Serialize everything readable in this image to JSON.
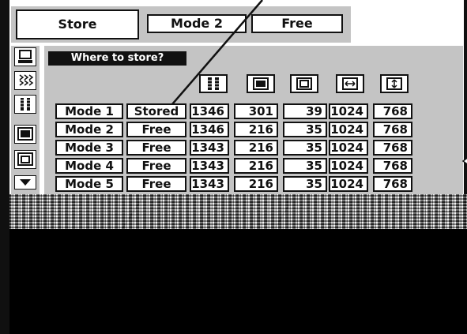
{
  "top_bar": {
    "store_label": "Store",
    "mode_label": "Mode 2",
    "free_label": "Free"
  },
  "panel": {
    "heading": "Where to store?",
    "column_icons": [
      "total-lines-icon",
      "horizontal-position-icon",
      "vertical-position-icon",
      "display-area-h-icon",
      "display-area-v-icon"
    ],
    "rows": [
      {
        "mode": "Mode 1",
        "status": "Stored",
        "total": "1346",
        "hpos": "301",
        "vpos": "39",
        "width": "1024",
        "height": "768"
      },
      {
        "mode": "Mode 2",
        "status": "Free",
        "total": "1346",
        "hpos": "216",
        "vpos": "35",
        "width": "1024",
        "height": "768"
      },
      {
        "mode": "Mode 3",
        "status": "Free",
        "total": "1343",
        "hpos": "216",
        "vpos": "35",
        "width": "1024",
        "height": "768"
      },
      {
        "mode": "Mode 4",
        "status": "Free",
        "total": "1343",
        "hpos": "216",
        "vpos": "35",
        "width": "1024",
        "height": "768"
      },
      {
        "mode": "Mode 5",
        "status": "Free",
        "total": "1343",
        "hpos": "216",
        "vpos": "35",
        "width": "1024",
        "height": "768"
      }
    ],
    "selected_row_marker": "left-arrow-icon"
  },
  "icon_column": [
    "computer-adjust-icon",
    "fine-sync-icon",
    "total-dots-icon",
    "position-icon",
    "display-area-icon",
    "scroll-down-icon"
  ],
  "colors": {
    "panel_bg": "#c4c4c4",
    "heading_bg": "#111111",
    "cell_bg": "#ffffff"
  }
}
